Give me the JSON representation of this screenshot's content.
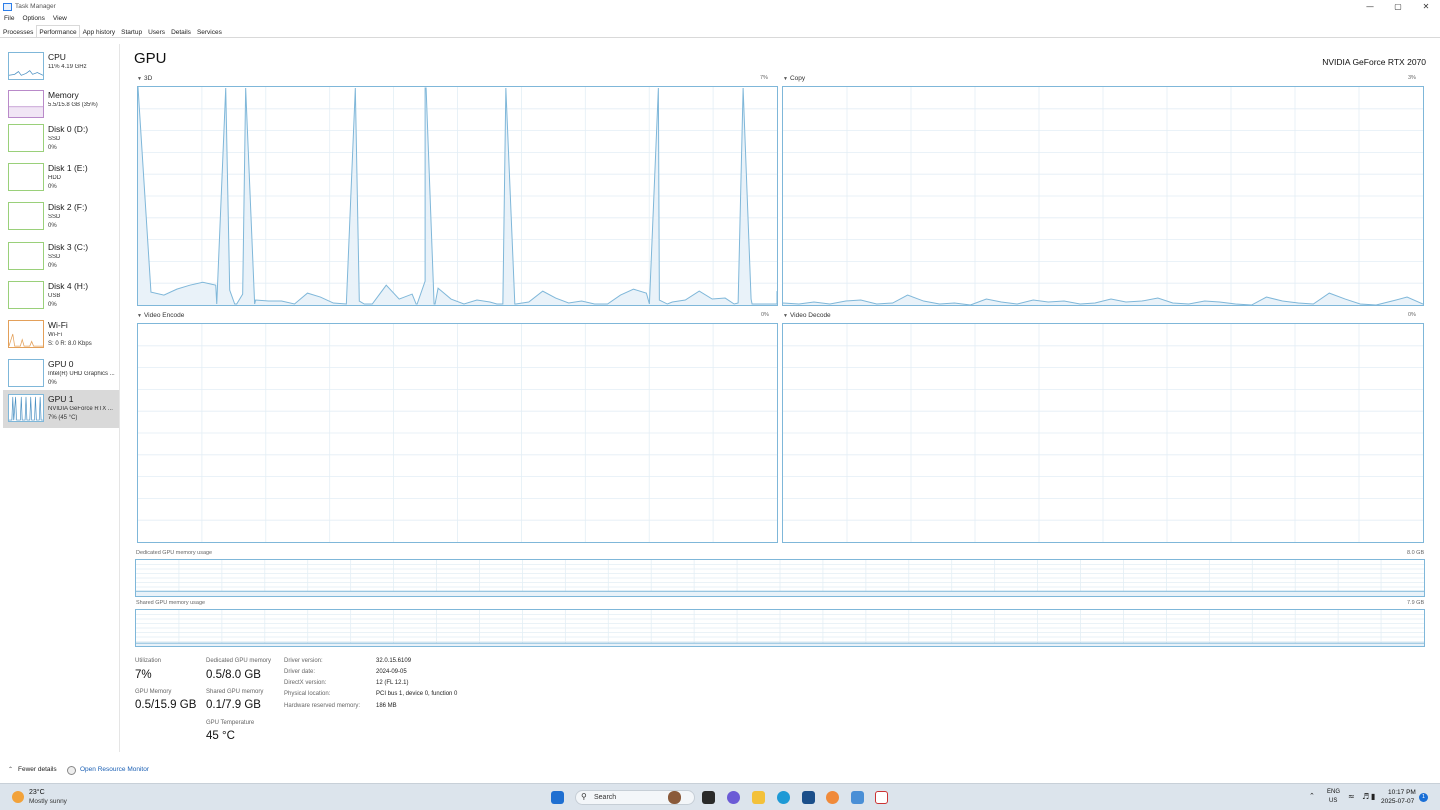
{
  "window": {
    "title": "Task Manager",
    "controls": [
      "—",
      "▢",
      "✕"
    ]
  },
  "menu": [
    "File",
    "Options",
    "View"
  ],
  "tabs": [
    {
      "label": "Processes"
    },
    {
      "label": "Performance",
      "active": true
    },
    {
      "label": "App history"
    },
    {
      "label": "Startup"
    },
    {
      "label": "Users"
    },
    {
      "label": "Details"
    },
    {
      "label": "Services"
    }
  ],
  "sidebar": {
    "items": [
      {
        "name": "CPU",
        "sub1": "11%  4.19 GHz",
        "sub2": ""
      },
      {
        "name": "Memory",
        "sub1": "5.5/15.8 GB (35%)",
        "sub2": ""
      },
      {
        "name": "Disk 0 (D:)",
        "sub1": "SSD",
        "sub2": "0%"
      },
      {
        "name": "Disk 1 (E:)",
        "sub1": "HDD",
        "sub2": "0%"
      },
      {
        "name": "Disk 2 (F:)",
        "sub1": "SSD",
        "sub2": "0%"
      },
      {
        "name": "Disk 3 (C:)",
        "sub1": "SSD",
        "sub2": "0%"
      },
      {
        "name": "Disk 4 (H:)",
        "sub1": "USB",
        "sub2": "0%"
      },
      {
        "name": "Wi-Fi",
        "sub1": "Wi-Fi",
        "sub2": "S: 0  R: 8.0 Kbps"
      },
      {
        "name": "GPU 0",
        "sub1": "Intel(R) UHD Graphics ...",
        "sub2": "0%"
      },
      {
        "name": "GPU 1",
        "sub1": "NVIDIA GeForce RTX ...",
        "sub2": "7% (45 °C)",
        "selected": true
      }
    ]
  },
  "main": {
    "title": "GPU",
    "gpu_model": "NVIDIA GeForce RTX 2070",
    "graphs": [
      {
        "label": "3D",
        "max": "7%"
      },
      {
        "label": "Copy",
        "max": "3%"
      },
      {
        "label": "Video Encode",
        "max": "0%"
      },
      {
        "label": "Video Decode",
        "max": "0%"
      }
    ],
    "dedicated": {
      "label": "Dedicated GPU memory usage",
      "max": "8.0 GB"
    },
    "shared": {
      "label": "Shared GPU memory usage",
      "max": "7.9 GB"
    }
  },
  "stats": {
    "utilization": {
      "label": "Utilization",
      "value": "7%"
    },
    "dedicated_mem": {
      "label": "Dedicated GPU memory",
      "value": "0.5/8.0 GB"
    },
    "gpu_memory": {
      "label": "GPU Memory",
      "value": "0.5/15.9 GB"
    },
    "shared_mem": {
      "label": "Shared GPU memory",
      "value": "0.1/7.9 GB"
    },
    "temperature": {
      "label": "GPU Temperature",
      "value": "45 °C"
    }
  },
  "info": [
    {
      "key": "Driver version:",
      "value": "32.0.15.6109"
    },
    {
      "key": "Driver date:",
      "value": "2024-09-05"
    },
    {
      "key": "DirectX version:",
      "value": "12 (FL 12.1)"
    },
    {
      "key": "Physical location:",
      "value": "PCI bus 1, device 0, function 0"
    },
    {
      "key": "Hardware reserved memory:",
      "value": "186 MB"
    }
  ],
  "footer": {
    "fewer_details": "Fewer details",
    "open_resmon": "Open Resource Monitor"
  },
  "taskbar": {
    "weather": {
      "temp": "23°C",
      "desc": "Mostly sunny",
      "icon": "sun-icon"
    },
    "search": "Search",
    "lang_line1": "ENG",
    "lang_line2": "US",
    "time": "10:17 PM",
    "date": "2025-07-07",
    "notification_count": "1"
  },
  "colors": {
    "graph_line": "#7fb7d9",
    "graph_fill": "#e9f2f9",
    "grid": "#e3eef5",
    "disk_green": "#9ad07a",
    "memory_purple": "#b98ac9",
    "wifi_orange": "#e3a05a"
  }
}
